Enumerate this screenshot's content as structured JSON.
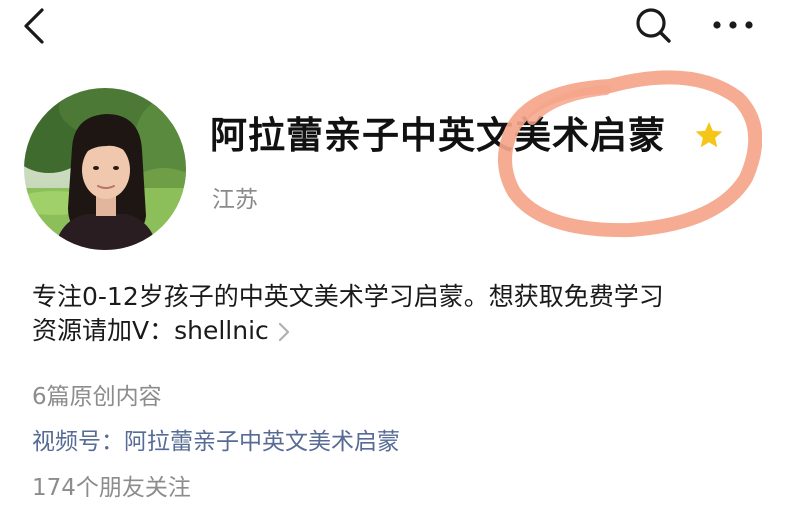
{
  "topbar": {
    "back_icon": "chevron-left-icon",
    "search_icon": "search-icon",
    "more_icon": "more-horizontal-icon"
  },
  "profile": {
    "avatar": "profile-avatar-photo",
    "name": "阿拉蕾亲子中英文美术启蒙",
    "badge_icon": "star-icon",
    "badge_color": "#f5c518",
    "region": "江苏"
  },
  "bio": {
    "line1": "专注0-12岁孩子的中英文美术学习启蒙。想获取免费学习",
    "line2": "资源请加V：shellnic",
    "chevron_icon": "chevron-right-icon"
  },
  "stats": {
    "original_count": "6篇原创内容",
    "channels_label": "视频号：",
    "channels_name": "阿拉蕾亲子中英文美术启蒙",
    "friends_following": "174个朋友关注"
  },
  "colors": {
    "link": "#576b95",
    "secondary_text": "#8c8c8c",
    "annotation_circle": "#f4a58a"
  }
}
